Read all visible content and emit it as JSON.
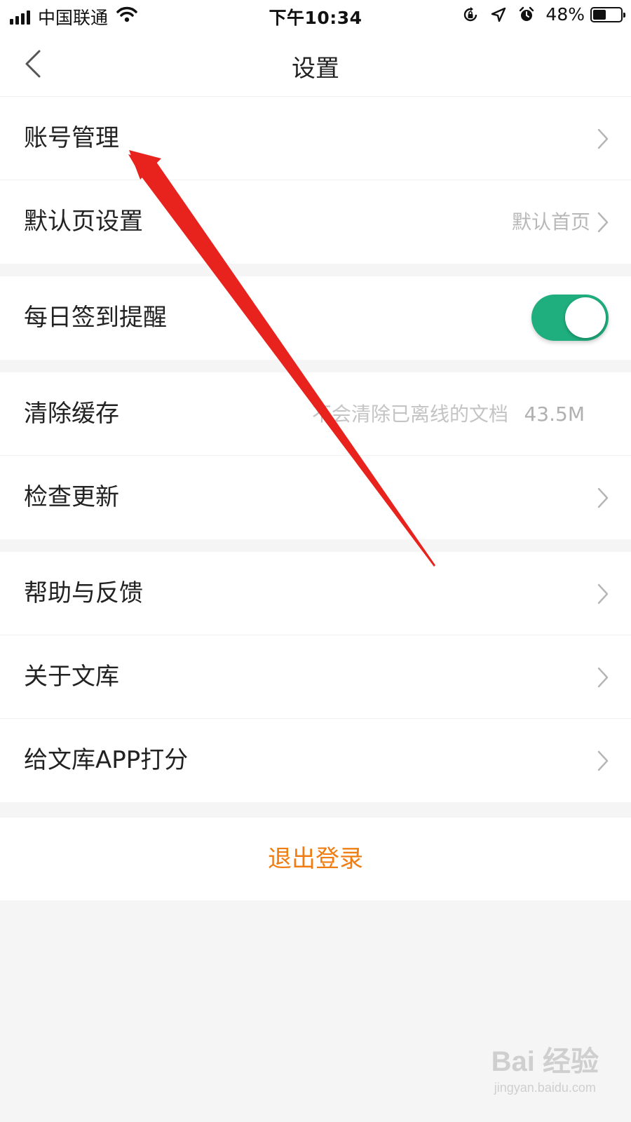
{
  "status_bar": {
    "carrier": "中国联通",
    "time": "下午10:34",
    "battery_percent": "48%",
    "battery_level": 0.48,
    "icons": [
      "signal-icon",
      "wifi-icon",
      "orientation-lock-icon",
      "location-icon",
      "alarm-icon",
      "battery-icon"
    ]
  },
  "nav": {
    "title": "设置",
    "back_icon": "chevron-left-icon"
  },
  "groups": {
    "account": {
      "account_management": {
        "label": "账号管理"
      },
      "default_page": {
        "label": "默认页设置",
        "value": "默认首页"
      }
    },
    "reminder": {
      "daily_checkin": {
        "label": "每日签到提醒",
        "enabled": true
      }
    },
    "cache": {
      "clear_cache": {
        "label": "清除缓存",
        "note": "不会清除已离线的文档",
        "size": "43.5M"
      },
      "check_update": {
        "label": "检查更新"
      }
    },
    "about": {
      "help_feedback": {
        "label": "帮助与反馈"
      },
      "about_library": {
        "label": "关于文库"
      },
      "rate_app": {
        "label": "给文库APP打分"
      }
    }
  },
  "logout": {
    "label": "退出登录"
  },
  "colors": {
    "accent_orange": "#f07d12",
    "toggle_green": "#1fae7d",
    "annotation_red": "#e8231d",
    "background": "#f5f5f5"
  },
  "watermark": {
    "logo": "Bai 经验",
    "url": "jingyan.baidu.com"
  }
}
